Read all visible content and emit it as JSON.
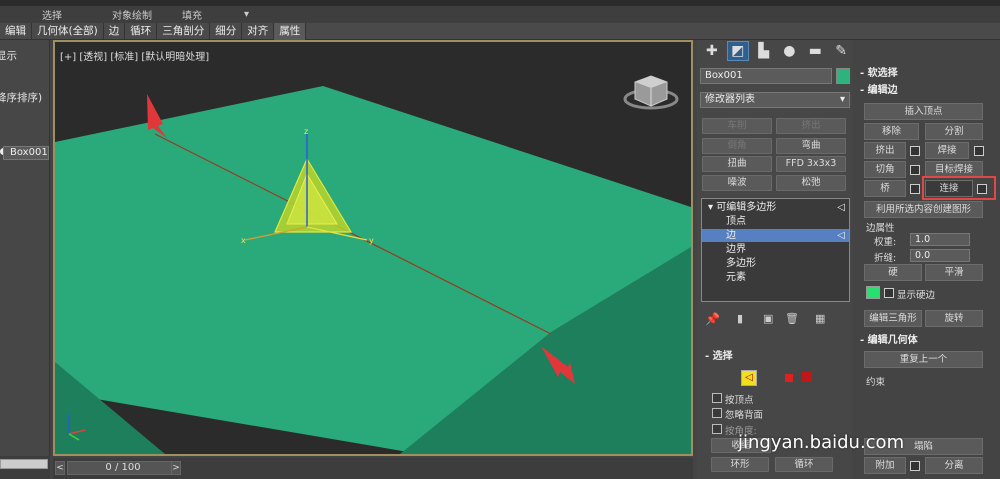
{
  "menubar": {
    "items": [
      "选择",
      "对象绘制",
      "填充"
    ]
  },
  "ribbon": {
    "items": [
      "编辑",
      "几何体(全部)",
      "边",
      "循环",
      "三角剖分",
      "细分",
      "对齐",
      "属性"
    ]
  },
  "left_panel": {
    "display_label": "显示",
    "sort_label": "降序排序)",
    "object": "Box001"
  },
  "viewport": {
    "label": "[+] [透视] [标准] [默认明暗处理]",
    "colors": {
      "plane": "#2aa97a",
      "plane_side": "#1e7f5c",
      "selection": "#d7d31a",
      "arrow": "#e0383a"
    },
    "gizmo_axes": {
      "x": "x",
      "y": "y",
      "z": "z"
    }
  },
  "timeline": {
    "slider": "0 / 100",
    "prev": "<",
    "next": ">"
  },
  "command_panel": {
    "object_name": "Box001",
    "object_color": "#2db37e",
    "modifier_list": "修改器列表",
    "buttons": [
      "车削",
      "挤出",
      "倒角",
      "弯曲",
      "扭曲",
      "FFD 3x3x3",
      "噪波",
      "松弛"
    ],
    "stack": {
      "root": "可编辑多边形",
      "items": [
        "顶点",
        "边",
        "边界",
        "多边形",
        "元素"
      ],
      "selected": "边"
    },
    "selection_rollout": {
      "title": "选择",
      "by_vertex": "按顶点",
      "ignore_backfacing": "忽略背面",
      "by_angle": "按角度:",
      "shrink": "收缩",
      "ring": "环形",
      "loop": "循环"
    }
  },
  "right_panel": {
    "soft_selection": "软选择",
    "edit_edges": {
      "title": "编辑边",
      "insert_vertex": "插入顶点",
      "remove": "移除",
      "split": "分割",
      "extrude": "挤出",
      "weld": "焊接",
      "chamfer": "切角",
      "target_weld": "目标焊接",
      "bridge": "桥",
      "connect": "连接",
      "create_shape": "利用所选内容创建图形",
      "edge_props": "边属性",
      "weight_label": "权重:",
      "weight": "1.0",
      "crease_label": "折缝:",
      "crease": "0.0",
      "hard": "硬",
      "smooth": "平滑",
      "display_hard": "显示硬边",
      "hard_color": "#28e070",
      "edit_tri": "编辑三角形",
      "turn": "旋转"
    },
    "edit_geometry": {
      "title": "编辑几何体",
      "repeat_last": "重复上一个",
      "constraints": "约束",
      "attach": "附加",
      "detach": "分离",
      "collapse": "塌陷"
    }
  },
  "watermark": "jingyan.baidu.com"
}
